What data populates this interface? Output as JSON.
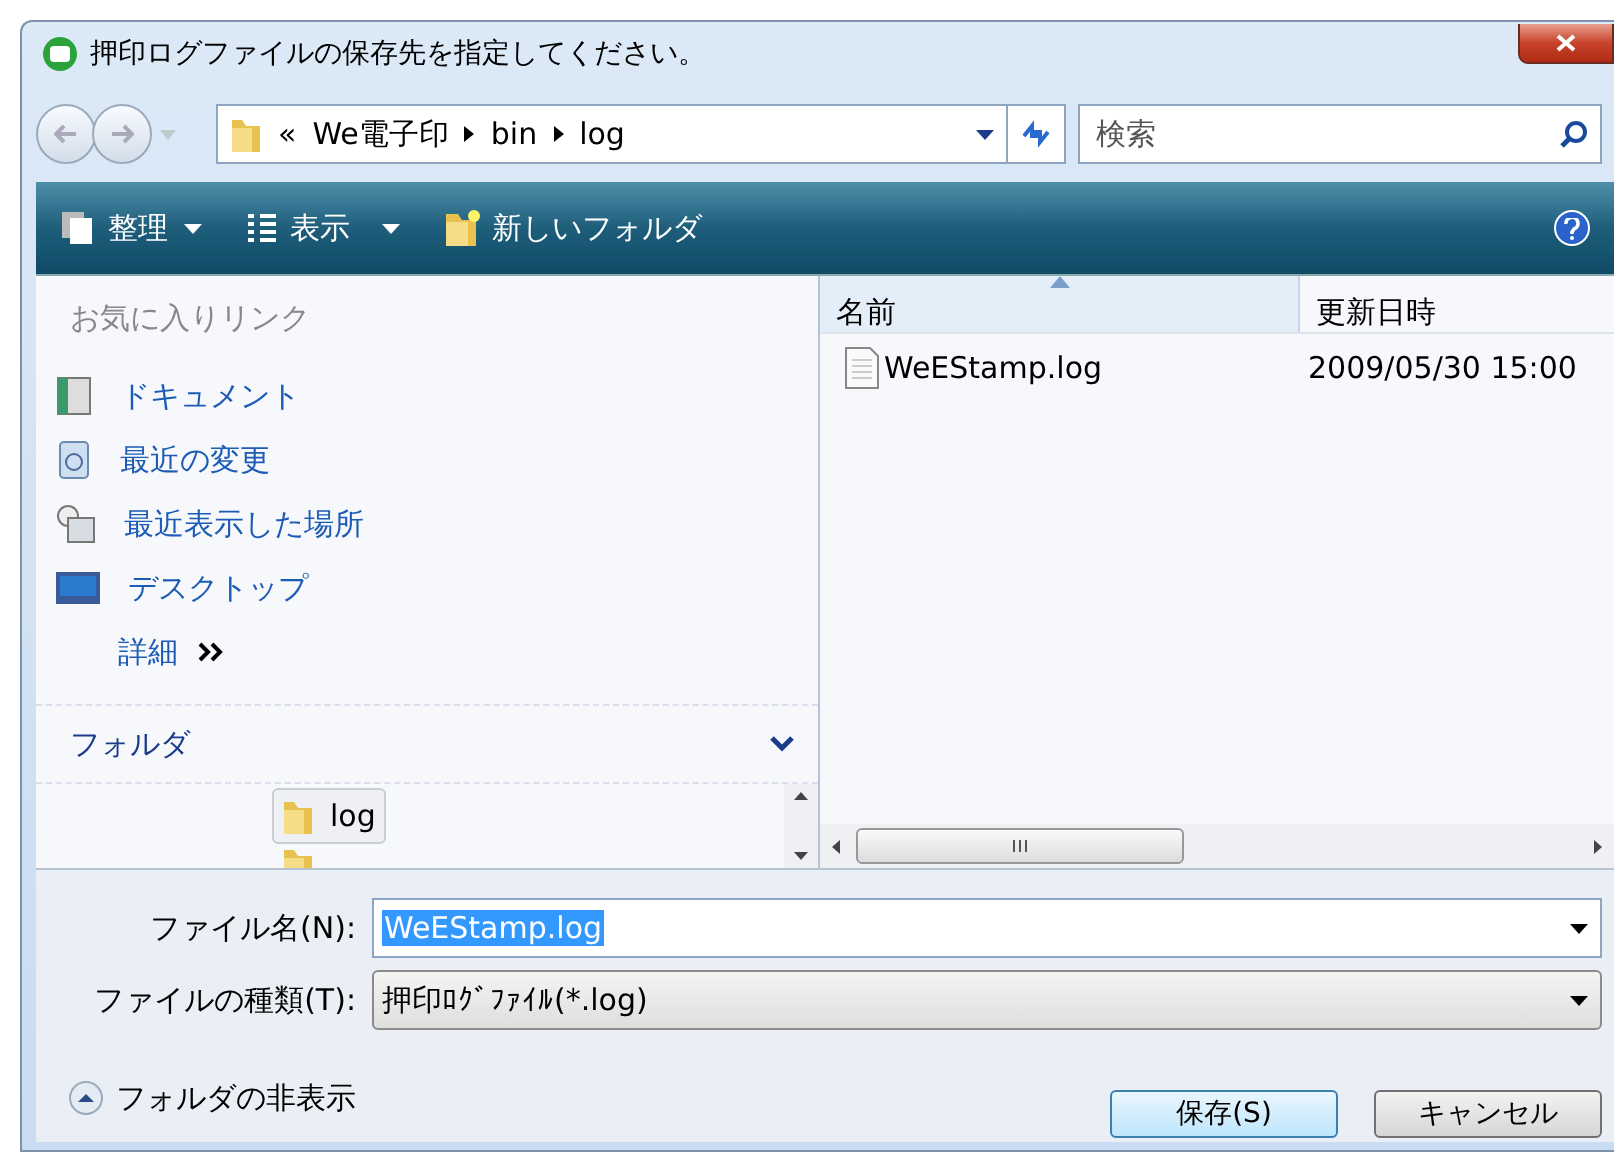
{
  "window": {
    "title": "押印ログファイルの保存先を指定してください。"
  },
  "address": {
    "overflow": "«",
    "crumbs": [
      "We電子印",
      "bin",
      "log"
    ]
  },
  "search": {
    "placeholder": "検索"
  },
  "toolbar": [
    {
      "label": "整理",
      "kind": "organize"
    },
    {
      "label": "表示",
      "kind": "views"
    },
    {
      "label": "新しいフォルダ",
      "kind": "newfolder"
    }
  ],
  "favorites": {
    "title": "お気に入りリンク",
    "items": [
      {
        "label": "ドキュメント",
        "kind": "documents"
      },
      {
        "label": "最近の変更",
        "kind": "recent"
      },
      {
        "label": "最近表示した場所",
        "kind": "places"
      },
      {
        "label": "デスクトップ",
        "kind": "desktop"
      }
    ],
    "more": "詳細"
  },
  "folders": {
    "title": "フォルダ",
    "expanded": true,
    "items": [
      {
        "label": "log",
        "selected": true
      }
    ]
  },
  "files": {
    "columns": [
      {
        "label": "名前",
        "sorted": true
      },
      {
        "label": "更新日時",
        "sorted": false
      }
    ],
    "rows": [
      {
        "name": "WeEStamp.log",
        "modified": "2009/05/30 15:00"
      }
    ]
  },
  "filename": {
    "label": "ファイル名(N):",
    "value": "WeEStamp.log",
    "selected": true
  },
  "filetype": {
    "label": "ファイルの種類(T):",
    "value": "押印ﾛｸﾞﾌｧｲﾙ(*.log)"
  },
  "hide_folders": "フォルダの非表示",
  "buttons": [
    {
      "label": "保存(S)",
      "default": true
    },
    {
      "label": "キャンセル",
      "default": false
    }
  ]
}
